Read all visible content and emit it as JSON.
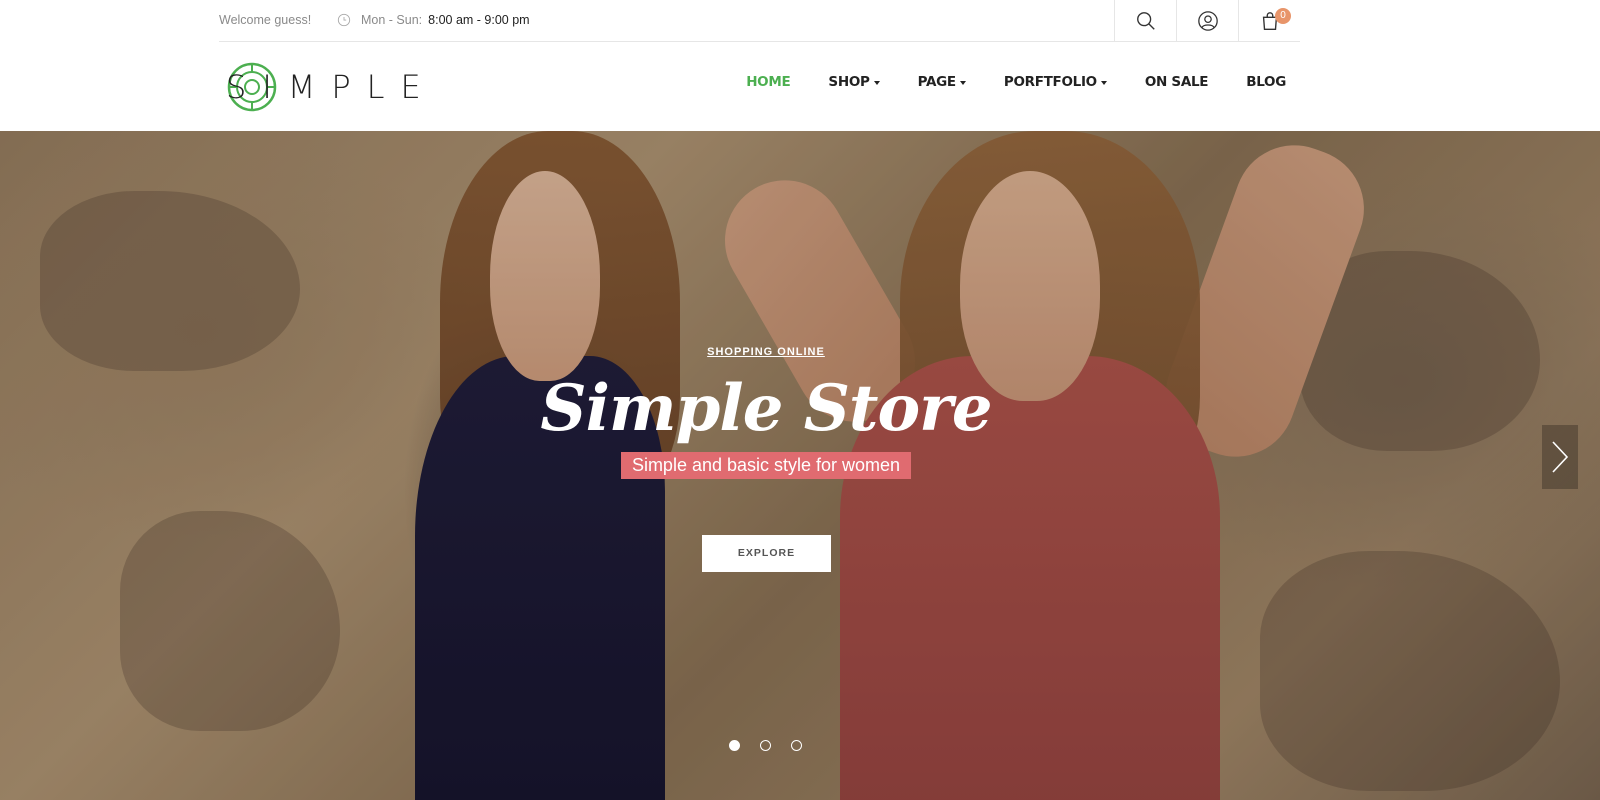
{
  "topbar": {
    "welcome": "Welcome guess!",
    "hours_days": "Mon - Sun:",
    "hours_time": "8:00 am - 9:00 pm",
    "icons": [
      "search-icon",
      "user-icon",
      "cart-icon"
    ],
    "cart_count": "0"
  },
  "header": {
    "logo_text": "SIMPLE",
    "nav": [
      {
        "label": "HOME",
        "active": true,
        "dropdown": false
      },
      {
        "label": "SHOP",
        "active": false,
        "dropdown": true
      },
      {
        "label": "PAGE",
        "active": false,
        "dropdown": true
      },
      {
        "label": "PORFTFOLIO",
        "active": false,
        "dropdown": true
      },
      {
        "label": "ON SALE",
        "active": false,
        "dropdown": false
      },
      {
        "label": "BLOG",
        "active": false,
        "dropdown": false
      }
    ]
  },
  "hero": {
    "eyebrow": "SHOPPING ONLINE",
    "title": "Simple Store",
    "subtitle": "Simple and basic style for women",
    "button_label": "EXPLORE",
    "slides_total": 3,
    "active_slide": 1
  },
  "colors": {
    "accent_green": "#4caf50",
    "subtitle_bg": "#e06b70",
    "badge": "#e8956a"
  }
}
